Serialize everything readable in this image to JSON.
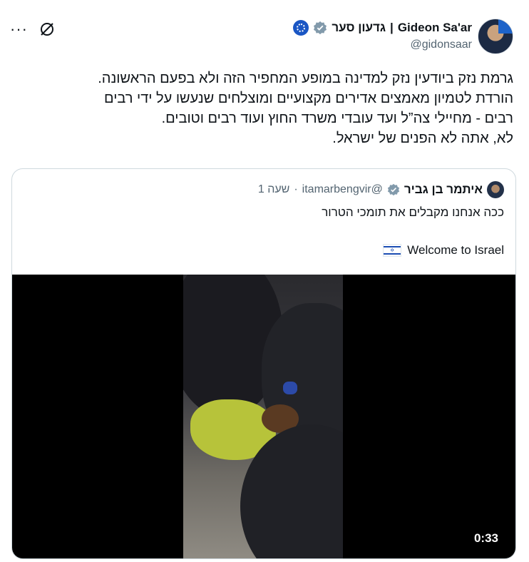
{
  "author": {
    "name_en": "Gideon Sa'ar",
    "separator": "|",
    "name_he": "גדעון סער",
    "handle": "@gidonsaar"
  },
  "actions": {
    "grok_icon": "slash-circle-icon",
    "more_label": "···"
  },
  "tweet": {
    "lines": [
      "גרמת נזק ביודעין נזק למדינה במופע המחפיר הזה ולא בפעם הראשונה.",
      "הורדת לטמיון מאמצים אדירים מקצועיים ומוצלחים שנעשו על ידי רבים",
      "רבים - מחיילי צה”ל ועד עובדי משרד החוץ ועוד רבים וטובים.",
      "לא, אתה לא הפנים של ישראל."
    ]
  },
  "quote": {
    "name": "איתמר בן גביר",
    "handle": "@itamarbengvir",
    "dot": "·",
    "time": "שעה 1",
    "line1": "ככה אנחנו מקבלים את תומכי הטרור",
    "line2": "Welcome to Israel",
    "video_duration": "0:33"
  },
  "colors": {
    "text": "#0f1419",
    "secondary": "#536471",
    "border": "#cfd9de",
    "verified": "#829aab"
  }
}
